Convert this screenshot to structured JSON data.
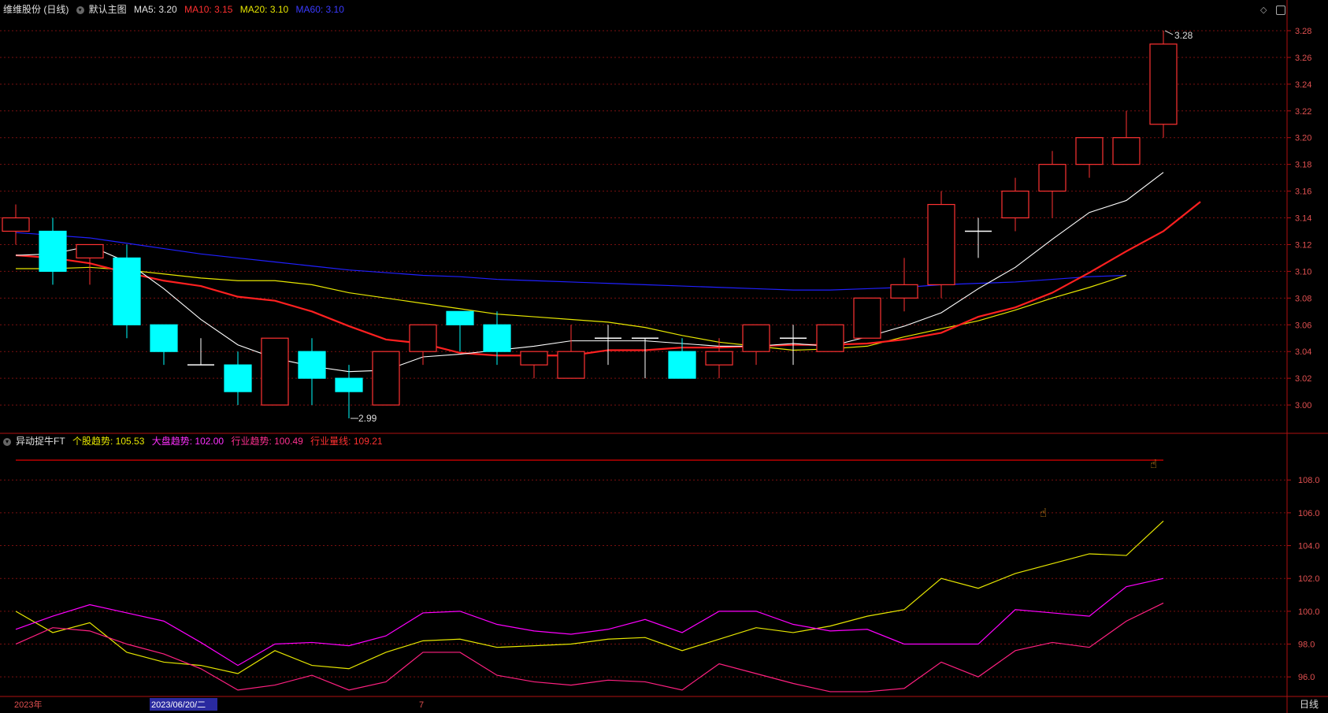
{
  "header": {
    "stock_name": "维维股份 (日线)",
    "main_chart_label": "默认主图",
    "ma5": "MA5: 3.20",
    "ma10": "MA10: 3.15",
    "ma20": "MA20: 3.10",
    "ma60": "MA60: 3.10"
  },
  "indicator_header": {
    "name": "异动捉牛FT",
    "stock_trend": "个股趋势: 105.53",
    "market_trend": "大盘趋势: 102.00",
    "industry_trend": "行业趋势: 100.49",
    "industry_line": "行业量线: 109.21"
  },
  "annotations": {
    "high": "3.28",
    "low": "2.99"
  },
  "date_axis": {
    "year": "2023年",
    "cursor_date": "2023/06/20/二",
    "month": "7",
    "period": "日线"
  },
  "colors": {
    "up": "#ff3232",
    "down": "#00ffff",
    "ma5": "#ffffff",
    "ma10": "#ff2020",
    "ma20": "#e6e600",
    "ma60": "#2020ff",
    "stock_trend": "#e6e600",
    "market_trend": "#ff00ff",
    "industry_trend": "#ff2080",
    "industry_line": "#cc0000"
  },
  "chart_data": [
    {
      "type": "candlestick",
      "ylim": [
        2.98,
        3.29
      ],
      "yticks": [
        3.0,
        3.02,
        3.04,
        3.06,
        3.08,
        3.1,
        3.12,
        3.14,
        3.16,
        3.18,
        3.2,
        3.22,
        3.24,
        3.26,
        3.28
      ],
      "candles": [
        {
          "o": 3.13,
          "h": 3.15,
          "l": 3.12,
          "c": 3.14
        },
        {
          "o": 3.13,
          "h": 3.14,
          "l": 3.09,
          "c": 3.1
        },
        {
          "o": 3.11,
          "h": 3.12,
          "l": 3.09,
          "c": 3.12
        },
        {
          "o": 3.11,
          "h": 3.12,
          "l": 3.05,
          "c": 3.06
        },
        {
          "o": 3.06,
          "h": 3.06,
          "l": 3.03,
          "c": 3.04
        },
        {
          "o": 3.03,
          "h": 3.05,
          "l": 3.03,
          "c": 3.03
        },
        {
          "o": 3.03,
          "h": 3.04,
          "l": 3.0,
          "c": 3.01
        },
        {
          "o": 3.0,
          "h": 3.05,
          "l": 3.0,
          "c": 3.05
        },
        {
          "o": 3.04,
          "h": 3.05,
          "l": 3.0,
          "c": 3.02
        },
        {
          "o": 3.02,
          "h": 3.03,
          "l": 2.99,
          "c": 3.01
        },
        {
          "o": 3.0,
          "h": 3.04,
          "l": 3.0,
          "c": 3.04
        },
        {
          "o": 3.04,
          "h": 3.06,
          "l": 3.03,
          "c": 3.06
        },
        {
          "o": 3.07,
          "h": 3.07,
          "l": 3.04,
          "c": 3.06
        },
        {
          "o": 3.06,
          "h": 3.07,
          "l": 3.03,
          "c": 3.04
        },
        {
          "o": 3.03,
          "h": 3.04,
          "l": 3.02,
          "c": 3.04
        },
        {
          "o": 3.02,
          "h": 3.06,
          "l": 3.02,
          "c": 3.04
        },
        {
          "o": 3.05,
          "h": 3.06,
          "l": 3.03,
          "c": 3.05
        },
        {
          "o": 3.05,
          "h": 3.05,
          "l": 3.02,
          "c": 3.05
        },
        {
          "o": 3.04,
          "h": 3.05,
          "l": 3.02,
          "c": 3.02
        },
        {
          "o": 3.03,
          "h": 3.05,
          "l": 3.02,
          "c": 3.04
        },
        {
          "o": 3.04,
          "h": 3.06,
          "l": 3.03,
          "c": 3.06
        },
        {
          "o": 3.05,
          "h": 3.06,
          "l": 3.03,
          "c": 3.05
        },
        {
          "o": 3.04,
          "h": 3.06,
          "l": 3.04,
          "c": 3.06
        },
        {
          "o": 3.05,
          "h": 3.08,
          "l": 3.05,
          "c": 3.08
        },
        {
          "o": 3.08,
          "h": 3.11,
          "l": 3.07,
          "c": 3.09
        },
        {
          "o": 3.09,
          "h": 3.16,
          "l": 3.08,
          "c": 3.15
        },
        {
          "o": 3.13,
          "h": 3.14,
          "l": 3.11,
          "c": 3.13
        },
        {
          "o": 3.14,
          "h": 3.17,
          "l": 3.13,
          "c": 3.16
        },
        {
          "o": 3.16,
          "h": 3.19,
          "l": 3.14,
          "c": 3.18
        },
        {
          "o": 3.18,
          "h": 3.2,
          "l": 3.17,
          "c": 3.2
        },
        {
          "o": 3.18,
          "h": 3.22,
          "l": 3.18,
          "c": 3.2
        },
        {
          "o": 3.21,
          "h": 3.28,
          "l": 3.2,
          "c": 3.27
        }
      ],
      "ma5": [
        3.112,
        3.113,
        3.119,
        3.107,
        3.087,
        3.064,
        3.045,
        3.035,
        3.029,
        3.025,
        3.026,
        3.036,
        3.038,
        3.041,
        3.044,
        3.048,
        3.048,
        3.048,
        3.046,
        3.044,
        3.044,
        3.046,
        3.044,
        3.051,
        3.059,
        3.069,
        3.087,
        3.103,
        3.124,
        3.144,
        3.153,
        3.174
      ],
      "ma10": [
        3.112,
        3.11,
        3.106,
        3.099,
        3.093,
        3.089,
        3.081,
        3.078,
        3.07,
        3.059,
        3.049,
        3.046,
        3.039,
        3.037,
        3.037,
        3.037,
        3.041,
        3.041,
        3.043,
        3.043,
        3.044,
        3.045,
        3.045,
        3.046,
        3.049,
        3.054,
        3.066,
        3.073,
        3.084,
        3.099,
        3.115,
        3.13,
        3.152
      ],
      "ma20": [
        3.102,
        3.102,
        3.103,
        3.101,
        3.098,
        3.095,
        3.093,
        3.093,
        3.09,
        3.084,
        3.08,
        3.076,
        3.072,
        3.068,
        3.066,
        3.064,
        3.062,
        3.058,
        3.052,
        3.047,
        3.044,
        3.041,
        3.042,
        3.044,
        3.051,
        3.057,
        3.063,
        3.071,
        3.08,
        3.088,
        3.097
      ],
      "ma60": [
        3.129,
        3.127,
        3.125,
        3.121,
        3.117,
        3.113,
        3.11,
        3.107,
        3.104,
        3.101,
        3.099,
        3.097,
        3.096,
        3.094,
        3.093,
        3.092,
        3.091,
        3.09,
        3.089,
        3.088,
        3.087,
        3.086,
        3.086,
        3.087,
        3.088,
        3.09,
        3.091,
        3.092,
        3.094,
        3.096,
        3.097
      ]
    },
    {
      "type": "line",
      "ylim": [
        95,
        109.5
      ],
      "yticks": [
        96.0,
        98.0,
        100.0,
        102.0,
        104.0,
        106.0,
        108.0
      ],
      "series": [
        {
          "name": "个股趋势",
          "values": [
            100.0,
            98.7,
            99.3,
            97.5,
            96.9,
            96.7,
            96.2,
            97.6,
            96.7,
            96.5,
            97.5,
            98.2,
            98.3,
            97.8,
            97.9,
            98.0,
            98.3,
            98.4,
            97.6,
            98.3,
            99.0,
            98.7,
            99.1,
            99.7,
            100.1,
            102.0,
            101.4,
            102.3,
            102.9,
            103.5,
            103.4,
            105.5
          ]
        },
        {
          "name": "大盘趋势",
          "values": [
            98.9,
            99.7,
            100.4,
            99.9,
            99.4,
            98.1,
            96.7,
            98.0,
            98.1,
            97.9,
            98.5,
            99.9,
            100.0,
            99.2,
            98.8,
            98.6,
            98.9,
            99.5,
            98.7,
            100.0,
            100.0,
            99.2,
            98.8,
            98.9,
            98.0,
            98.0,
            98.0,
            100.1,
            99.9,
            99.7,
            101.5,
            102.0
          ]
        },
        {
          "name": "行业趋势",
          "values": [
            98.0,
            99.0,
            98.8,
            98.0,
            97.4,
            96.5,
            95.2,
            95.5,
            96.1,
            95.2,
            95.7,
            97.5,
            97.5,
            96.1,
            95.7,
            95.5,
            95.8,
            95.7,
            95.2,
            96.8,
            96.2,
            95.6,
            95.1,
            95.1,
            95.3,
            96.9,
            96.0,
            97.6,
            98.1,
            97.8,
            99.4,
            100.5
          ]
        },
        {
          "name": "行业量线",
          "values": [
            109.21
          ]
        }
      ]
    }
  ]
}
